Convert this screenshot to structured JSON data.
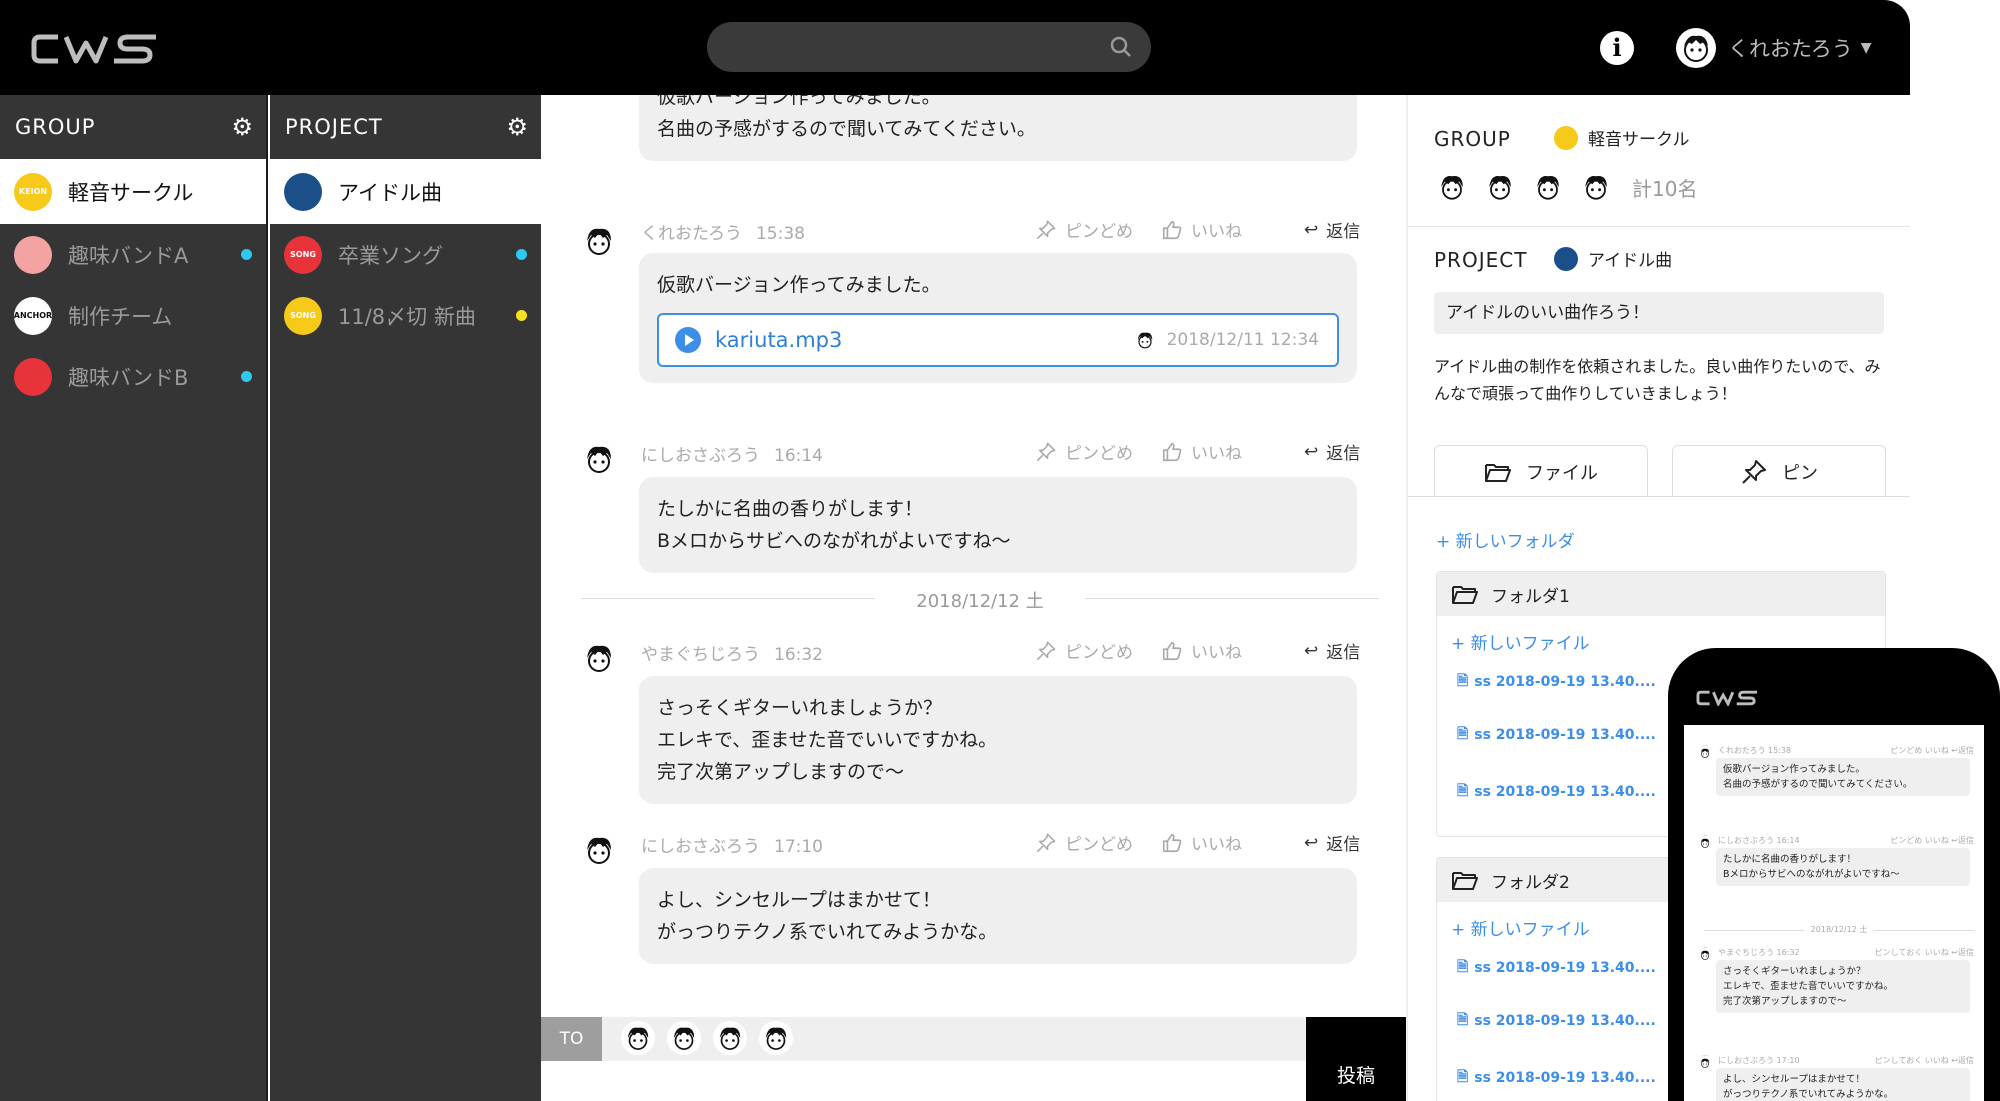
{
  "app": {
    "logo": "CWS"
  },
  "header": {
    "search_placeholder": "",
    "user_name": "くれおたろう"
  },
  "group_column": {
    "title": "GROUP",
    "items": [
      {
        "label": "軽音サークル",
        "logo_text": "KEION",
        "logo_color": "#f7c919",
        "active": true,
        "unread": false
      },
      {
        "label": "趣味バンドA",
        "logo_text": "",
        "logo_color": "#f4a3a3",
        "active": false,
        "unread": true,
        "unread_color": "#2ec8f5"
      },
      {
        "label": "制作チーム",
        "logo_text": "ANCHOR",
        "logo_color": "#ffffff",
        "active": false,
        "unread": false
      },
      {
        "label": "趣味バンドB",
        "logo_text": "",
        "logo_color": "#e8333a",
        "active": false,
        "unread": true,
        "unread_color": "#2ec8f5"
      }
    ]
  },
  "project_column": {
    "title": "PROJECT",
    "items": [
      {
        "label": "アイドル曲",
        "logo_text": "",
        "logo_color": "#1b4f8a",
        "active": true,
        "unread": false
      },
      {
        "label": "卒業ソング",
        "logo_text": "SONG",
        "logo_color": "#e8333a",
        "active": false,
        "unread": true,
        "unread_color": "#2ec8f5"
      },
      {
        "label": "11/8〆切 新曲",
        "logo_text": "SONG",
        "logo_color": "#f7c919",
        "active": false,
        "unread": true,
        "unread_color": "#f5e21b"
      }
    ]
  },
  "chat": {
    "messages": [
      {
        "author": "",
        "time": "",
        "text": "仮歌バージョン作ってみました。\n名曲の予感がするので聞いてみてください。"
      },
      {
        "author": "くれおたろう",
        "time": "15:38",
        "text": "仮歌バージョン作ってみました。",
        "attachment": {
          "name": "kariuta.mp3",
          "date": "2018/12/11 12:34"
        }
      },
      {
        "author": "にしおさぶろう",
        "time": "16:14",
        "text": "たしかに名曲の香りがします！\nBメロからサビへのながれがよいですね〜"
      },
      {
        "author": "やまぐちじろう",
        "time": "16:32",
        "text": "さっそくギターいれましょうか？\nエレキで、歪ませた音でいいですかね。\n完了次第アップしますので〜"
      },
      {
        "author": "にしおさぶろう",
        "time": "17:10",
        "text": "よし、シンセループはまかせて！\nがっつりテクノ系でいれてみようかな。"
      }
    ],
    "actions": {
      "pin": "ピンどめ",
      "like": "いいね",
      "reply": "返信"
    },
    "date_separator": "2018/12/12 土",
    "composer": {
      "to_label": "TO",
      "post_label": "投稿"
    }
  },
  "info_panel": {
    "group_title": "GROUP",
    "group_name": "軽音サークル",
    "member_count": "計10名",
    "project_title": "PROJECT",
    "project_name": "アイドル曲",
    "topic": "アイドルのいい曲作ろう！",
    "description": "アイドル曲の制作を依頼されました。良い曲作りたいので、みんなで頑張って曲作りしていきましょう！",
    "tabs": [
      {
        "label": "ファイル"
      },
      {
        "label": "ピン"
      }
    ],
    "new_folder": "+ 新しいフォルダ",
    "folders": [
      {
        "name": "フォルダ1",
        "new_file": "+ 新しいファイル",
        "files": [
          "ss 2018-09-19 13.40....",
          "ss 2018-09-19 13.40....",
          "ss 2018-09-19 13.40...."
        ]
      },
      {
        "name": "フォルダ2",
        "new_file": "+ 新しいファイル",
        "files": [
          "ss 2018-09-19 13.40....",
          "ss 2018-09-19 13.40....",
          "ss 2018-09-19 13.40...."
        ]
      }
    ]
  },
  "phone": {
    "logo": "CWS",
    "messages": [
      {
        "meta": "くれおたろう  15:38",
        "actions": "ピンどめ  いいね  ↩返信",
        "text": "仮歌バージョン作ってみました。\n名曲の予感がするので聞いてみてください。"
      },
      {
        "meta": "にしおさぶろう  16:14",
        "actions": "ピンどめ  いいね  ↩返信",
        "text": "たしかに名曲の香りがします！\nBメロからサビへのながれがよいですね〜"
      },
      {
        "meta": "やまぐちじろう  16:32",
        "actions": "ピンしておく  いいね  ↩返信",
        "text": "さっそくギターいれましょうか？\nエレキで、歪ませた音でいいですかね。\n完了次第アップしますので〜"
      },
      {
        "meta": "にしおさぶろう  17:10",
        "actions": "ピンしておく  いいね  ↩返信",
        "text": "よし、シンセループはまかせて！\nがっつりテクノ系でいれてみようかな。"
      }
    ],
    "date_separator": "2018/12/12 土"
  }
}
